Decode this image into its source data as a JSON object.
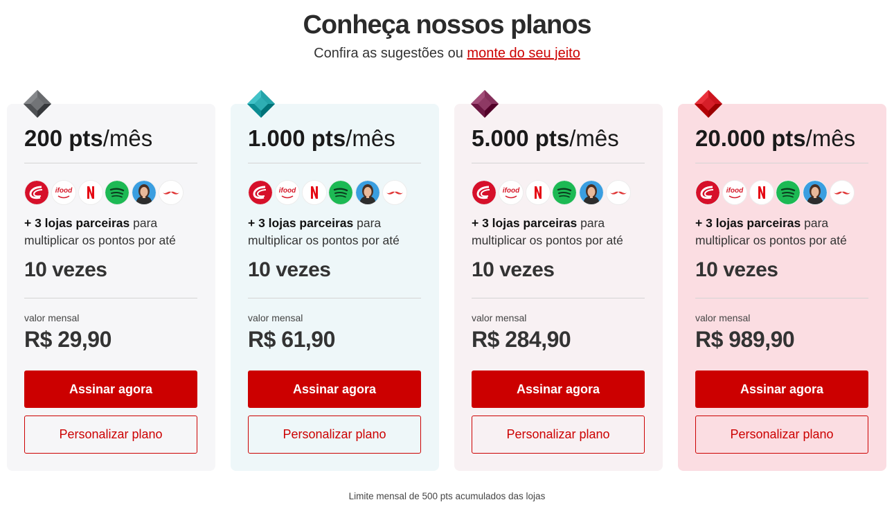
{
  "header": {
    "title": "Conheça nossos planos",
    "subtitle_prefix": "Confira as sugestões ou ",
    "subtitle_link": "monte do seu jeito"
  },
  "colors": {
    "accent": "#cc0000",
    "card_backgrounds": [
      "#f6f6f8",
      "#eef7f9",
      "#f8f1f3",
      "#fbdde2"
    ],
    "gem_colors": [
      "#5e6063",
      "#1a9aa0",
      "#7a2550",
      "#c20a14"
    ]
  },
  "partner_icons": [
    "livelo-icon",
    "ifood-icon",
    "netflix-icon",
    "spotify-icon",
    "influencer-avatar-icon",
    "mustache-icon"
  ],
  "plans": [
    {
      "points": "200 pts",
      "period": "/mês",
      "partners_bold": "+ 3 lojas parceiras",
      "partners_text": " para multiplicar os pontos por até",
      "multiplier": "10 vezes",
      "price_label": "valor mensal",
      "price": "R$ 29,90",
      "cta_primary": "Assinar agora",
      "cta_secondary": "Personalizar plano"
    },
    {
      "points": "1.000 pts",
      "period": "/mês",
      "partners_bold": "+ 3 lojas parceiras",
      "partners_text": " para multiplicar os pontos por até",
      "multiplier": "10 vezes",
      "price_label": "valor mensal",
      "price": "R$ 61,90",
      "cta_primary": "Assinar agora",
      "cta_secondary": "Personalizar plano"
    },
    {
      "points": "5.000 pts",
      "period": "/mês",
      "partners_bold": "+ 3 lojas parceiras",
      "partners_text": " para multiplicar os pontos por até",
      "multiplier": "10 vezes",
      "price_label": "valor mensal",
      "price": "R$ 284,90",
      "cta_primary": "Assinar agora",
      "cta_secondary": "Personalizar plano"
    },
    {
      "points": "20.000 pts",
      "period": "/mês",
      "partners_bold": "+ 3 lojas parceiras",
      "partners_text": " para multiplicar os pontos por até",
      "multiplier": "10 vezes",
      "price_label": "valor mensal",
      "price": "R$ 989,90",
      "cta_primary": "Assinar agora",
      "cta_secondary": "Personalizar plano"
    }
  ],
  "footnote": "Limite mensal de 500 pts acumulados das lojas"
}
